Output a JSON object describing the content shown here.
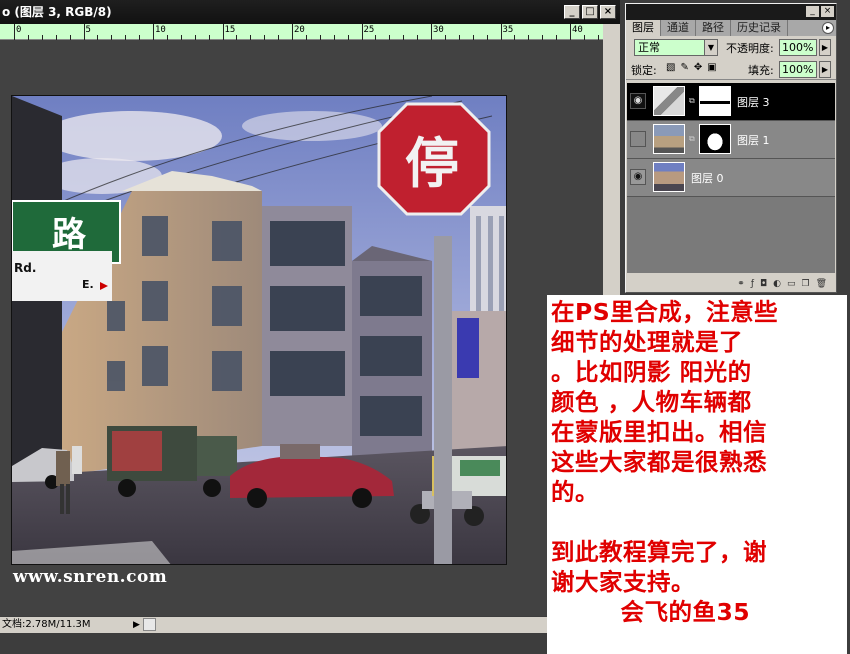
{
  "document": {
    "title": "o (图层 3, RGB/8)",
    "window_buttons": [
      "_",
      "□",
      "×"
    ],
    "ruler_numbers": [
      "0",
      "5",
      "10",
      "15",
      "20",
      "25",
      "30",
      "35",
      "40"
    ],
    "status": {
      "doc_size": "文档:2.78M/11.3M",
      "arrow": "▶"
    },
    "watermark": "www.snren.com",
    "photo_signs": {
      "stop": "停",
      "street": "路",
      "street_small": "Rd.",
      "street_dir": "E."
    }
  },
  "layers_panel": {
    "tabs": [
      "图层",
      "通道",
      "路径",
      "历史记录"
    ],
    "blend_mode": "正常",
    "opacity_label": "不透明度:",
    "opacity_value": "100%",
    "lock_label": "锁定:",
    "fill_label": "填充:",
    "fill_value": "100%",
    "layers": [
      {
        "name": "图层 3",
        "visible": true,
        "selected": true,
        "has_mask": true
      },
      {
        "name": "图层 1",
        "visible": false,
        "selected": false,
        "has_mask": true
      },
      {
        "name": "图层 0",
        "visible": true,
        "selected": false,
        "has_mask": false
      }
    ]
  },
  "note": {
    "text": "在PS里合成，注意些\n细节的处理就是了\n。比如阴影 阳光的\n颜色 ，人物车辆都\n在蒙版里扣出。相信\n这些大家都是很熟悉\n的。\n\n到此教程算完了，谢\n谢大家支持。\n        会飞的鱼35",
    "color": "#e00000"
  }
}
